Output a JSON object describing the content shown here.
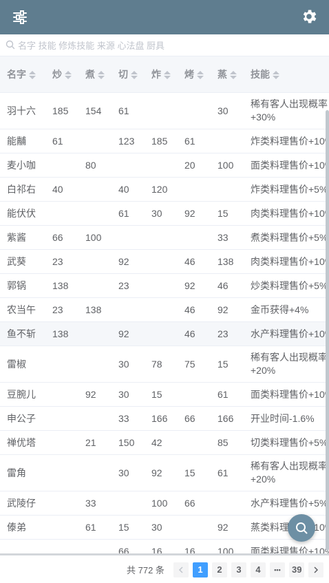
{
  "colors": {
    "header_bg": "#5f7d8f",
    "accent": "#409eff",
    "fab_bg": "#6d8fa4"
  },
  "search": {
    "placeholder": "名字 技能 修炼技能 来源 心法盘 厨具",
    "value": ""
  },
  "table": {
    "headers": {
      "name": "名字",
      "stir_fry": "炒",
      "boil": "煮",
      "cut": "切",
      "fry": "炸",
      "roast": "烤",
      "steam": "蒸",
      "skill": "技能"
    },
    "rows": [
      {
        "name": "羽十六",
        "stir_fry": "185",
        "boil": "154",
        "cut": "61",
        "fry": "",
        "roast": "",
        "steam": "30",
        "skill": "稀有客人出现概率+30%"
      },
      {
        "name": "能黼",
        "stir_fry": "61",
        "boil": "",
        "cut": "123",
        "fry": "185",
        "roast": "61",
        "steam": "",
        "skill": "炸类料理售价+10%"
      },
      {
        "name": "麦小咖",
        "stir_fry": "",
        "boil": "80",
        "cut": "",
        "fry": "",
        "roast": "20",
        "steam": "100",
        "skill": "面类料理售价+10%"
      },
      {
        "name": "白祁右",
        "stir_fry": "40",
        "boil": "",
        "cut": "40",
        "fry": "120",
        "roast": "",
        "steam": "",
        "skill": "炸类料理售价+5%"
      },
      {
        "name": "能伏伏",
        "stir_fry": "",
        "boil": "",
        "cut": "61",
        "fry": "30",
        "roast": "92",
        "steam": "15",
        "skill": "肉类料理售价+10%"
      },
      {
        "name": "紫酱",
        "stir_fry": "66",
        "boil": "100",
        "cut": "",
        "fry": "",
        "roast": "",
        "steam": "33",
        "skill": "煮类料理售价+5%"
      },
      {
        "name": "武葵",
        "stir_fry": "23",
        "boil": "",
        "cut": "92",
        "fry": "",
        "roast": "46",
        "steam": "138",
        "skill": "肉类料理售价+10%"
      },
      {
        "name": "郭锅",
        "stir_fry": "138",
        "boil": "",
        "cut": "23",
        "fry": "",
        "roast": "92",
        "steam": "46",
        "skill": "炒类料理售价+5%"
      },
      {
        "name": "农当午",
        "stir_fry": "23",
        "boil": "138",
        "cut": "",
        "fry": "",
        "roast": "46",
        "steam": "92",
        "skill": "金币获得+4%"
      },
      {
        "name": "鱼不斩",
        "stir_fry": "138",
        "boil": "",
        "cut": "92",
        "fry": "",
        "roast": "46",
        "steam": "23",
        "skill": "水产料理售价+10%"
      },
      {
        "name": "雷椒",
        "stir_fry": "",
        "boil": "",
        "cut": "30",
        "fry": "78",
        "roast": "75",
        "steam": "15",
        "skill": "稀有客人出现概率+20%"
      },
      {
        "name": "豆腕儿",
        "stir_fry": "",
        "boil": "92",
        "cut": "30",
        "fry": "15",
        "roast": "",
        "steam": "61",
        "skill": "面类料理售价+10%"
      },
      {
        "name": "申公子",
        "stir_fry": "",
        "boil": "",
        "cut": "33",
        "fry": "166",
        "roast": "66",
        "steam": "166",
        "skill": "开业时间-1.6%"
      },
      {
        "name": "禅优塔",
        "stir_fry": "",
        "boil": "21",
        "cut": "150",
        "fry": "42",
        "roast": "",
        "steam": "85",
        "skill": "切类料理售价+5%"
      },
      {
        "name": "雷角",
        "stir_fry": "",
        "boil": "",
        "cut": "30",
        "fry": "92",
        "roast": "15",
        "steam": "61",
        "skill": "稀有客人出现概率+20%"
      },
      {
        "name": "武陵仔",
        "stir_fry": "",
        "boil": "33",
        "cut": "",
        "fry": "100",
        "roast": "66",
        "steam": "",
        "skill": "水产料理售价+5%"
      },
      {
        "name": "傣弟",
        "stir_fry": "",
        "boil": "61",
        "cut": "15",
        "fry": "30",
        "roast": "",
        "steam": "92",
        "skill": "蒸类料理售价+10%"
      },
      {
        "name": "",
        "stir_fry": "",
        "boil": "",
        "cut": "66",
        "fry": "16",
        "roast": "16",
        "steam": "100",
        "skill": "面类料理售价+10%"
      }
    ]
  },
  "pagination": {
    "total_label": "共 772 条",
    "pages": [
      "1",
      "2",
      "3",
      "4",
      "39"
    ],
    "more": "•••",
    "current": "1"
  }
}
